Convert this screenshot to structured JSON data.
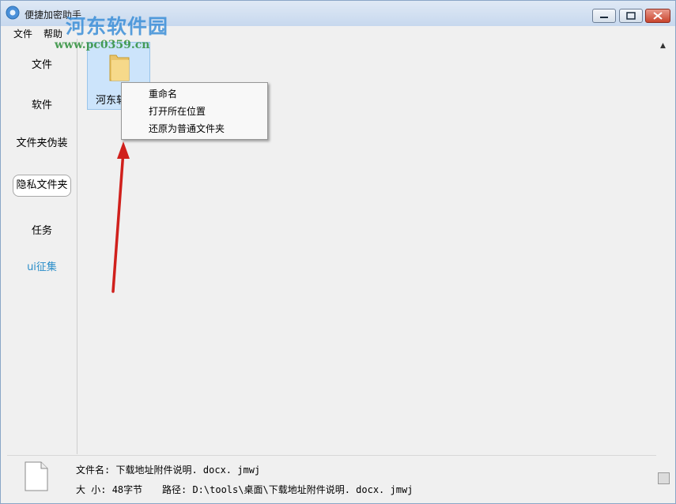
{
  "window": {
    "title": "便捷加密助手",
    "watermark_text": "河东软件园",
    "watermark_url": "www.pc0359.cn"
  },
  "menu": [
    "文件",
    "帮助"
  ],
  "sidebar": {
    "items": [
      {
        "label": "文件"
      },
      {
        "label": "软件"
      },
      {
        "label": "文件夹伪装"
      },
      {
        "label": "隐私文件夹",
        "selected": true
      },
      {
        "label": "任务"
      },
      {
        "label": "ui征集",
        "accent": true
      }
    ]
  },
  "main": {
    "file_tile_label": "河东软"
  },
  "context_menu": {
    "items": [
      "重命名",
      "打开所在位置",
      "还原为普通文件夹"
    ]
  },
  "status": {
    "filename_label": "文件名: ",
    "filename_value": "下载地址附件说明. docx. jmwj",
    "size_label": "大  小: ",
    "size_value": "48字节",
    "path_label": "路径: ",
    "path_value": "D:\\tools\\桌面\\下载地址附件说明. docx. jmwj"
  },
  "colors": {
    "accent": "#2b8ec9",
    "arrow": "#d0201c",
    "selection": "#cce4fb"
  }
}
